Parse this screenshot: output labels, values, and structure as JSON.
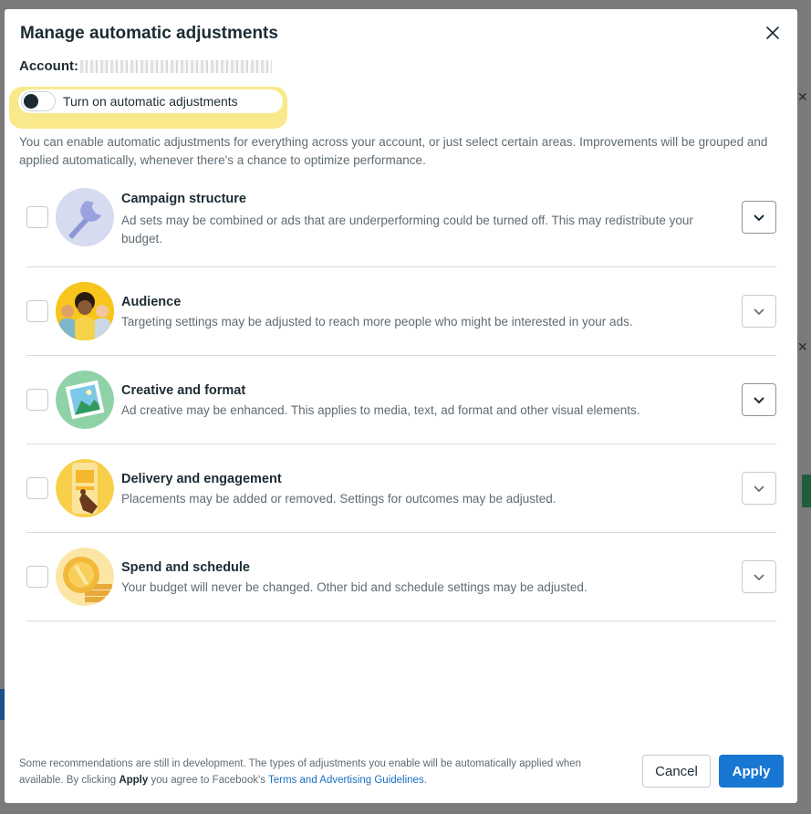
{
  "dialog": {
    "title": "Manage automatic adjustments",
    "account_label": "Account:"
  },
  "toggle": {
    "label": "Turn on automatic adjustments",
    "state": "off"
  },
  "intro": "You can enable automatic adjustments for everything across your account, or just select certain areas. Improvements will be grouped and applied automatically, whenever there's a chance to optimize performance.",
  "items": [
    {
      "title": "Campaign structure",
      "description": "Ad sets may be combined or ads that are underperforming could be turned off. This may redistribute your budget.",
      "icon": "wrench-icon"
    },
    {
      "title": "Audience",
      "description": "Targeting settings may be adjusted to reach more people who might be interested in your ads.",
      "icon": "people-icon"
    },
    {
      "title": "Creative and format",
      "description": "Ad creative may be enhanced. This applies to media, text, ad format and other visual elements.",
      "icon": "image-icon"
    },
    {
      "title": "Delivery and engagement",
      "description": "Placements may be added or removed. Settings for outcomes may be adjusted.",
      "icon": "tap-phone-icon"
    },
    {
      "title": "Spend and schedule",
      "description": "Your budget will never be changed. Other bid and schedule settings may be adjusted.",
      "icon": "coins-icon"
    }
  ],
  "footer": {
    "text_part1": "Some recommendations are still in development. The types of adjustments you enable will be automatically applied when available. By clicking ",
    "apply_word": "Apply",
    "text_part2": " you agree to Facebook's ",
    "link": "Terms and Advertising Guidelines",
    "text_part3": ".",
    "cancel": "Cancel",
    "apply": "Apply"
  },
  "colors": {
    "primary": "#1877d2",
    "highlight": "#f9e98a",
    "text": "#1c2b33",
    "muted": "#5f6b73"
  }
}
